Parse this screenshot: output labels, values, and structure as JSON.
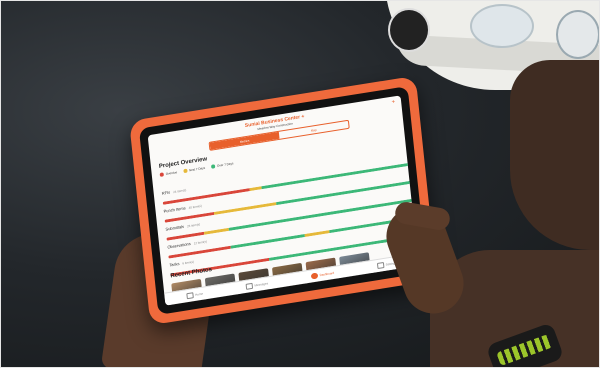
{
  "app": {
    "title": "Suniai Business Center +",
    "subtitle": "Meadow Way Construction",
    "add_icon": "plus-icon"
  },
  "segments": [
    {
      "label": "Metrics",
      "active": true
    },
    {
      "label": "Map",
      "active": false
    }
  ],
  "overview": {
    "title": "Project Overview",
    "legend": [
      {
        "label": "Overdue",
        "color": "#d9463a"
      },
      {
        "label": "Next 7 Days",
        "color": "#e6b93a"
      },
      {
        "label": "Over 7 Days",
        "color": "#3cb878"
      }
    ],
    "rows": [
      {
        "label": "RFIs",
        "count": "24 item(s)",
        "segments": [
          {
            "pct": 35,
            "color": "#d9463a"
          },
          {
            "pct": 5,
            "color": "#e6b93a"
          },
          {
            "pct": 60,
            "color": "#3cb878"
          }
        ]
      },
      {
        "label": "Punch Items",
        "count": "40 item(s)",
        "segments": [
          {
            "pct": 20,
            "color": "#d9463a"
          },
          {
            "pct": 25,
            "color": "#e6b93a"
          },
          {
            "pct": 55,
            "color": "#3cb878"
          }
        ]
      },
      {
        "label": "Submittals",
        "count": "26 item(s)",
        "segments": [
          {
            "pct": 15,
            "color": "#d9463a"
          },
          {
            "pct": 10,
            "color": "#e6b93a"
          },
          {
            "pct": 75,
            "color": "#3cb878"
          }
        ]
      },
      {
        "label": "Observations",
        "count": "12 item(s)",
        "segments": [
          {
            "pct": 25,
            "color": "#d9463a"
          },
          {
            "pct": 30,
            "color": "#3cb878"
          },
          {
            "pct": 10,
            "color": "#e6b93a"
          },
          {
            "pct": 35,
            "color": "#3cb878"
          }
        ]
      },
      {
        "label": "Tasks",
        "count": "6 item(s)",
        "segments": [
          {
            "pct": 40,
            "color": "#d9463a"
          },
          {
            "pct": 60,
            "color": "#3cb878"
          }
        ]
      }
    ]
  },
  "photos": {
    "title": "Recent Photos",
    "items": [
      {
        "color": "#b08a64"
      },
      {
        "color": "#6c6a66"
      },
      {
        "color": "#5b4a3a"
      },
      {
        "color": "#8a6a44"
      },
      {
        "color": "#9a6a4a"
      },
      {
        "color": "#7c8a96"
      }
    ]
  },
  "tabbar": [
    {
      "label": "Home",
      "icon": "home-icon",
      "active": false
    },
    {
      "label": "Messages",
      "icon": "messages-icon",
      "active": false
    },
    {
      "label": "Dashboard",
      "icon": "dashboard-icon",
      "active": true
    },
    {
      "label": "Settings",
      "icon": "settings-icon",
      "active": false
    }
  ]
}
